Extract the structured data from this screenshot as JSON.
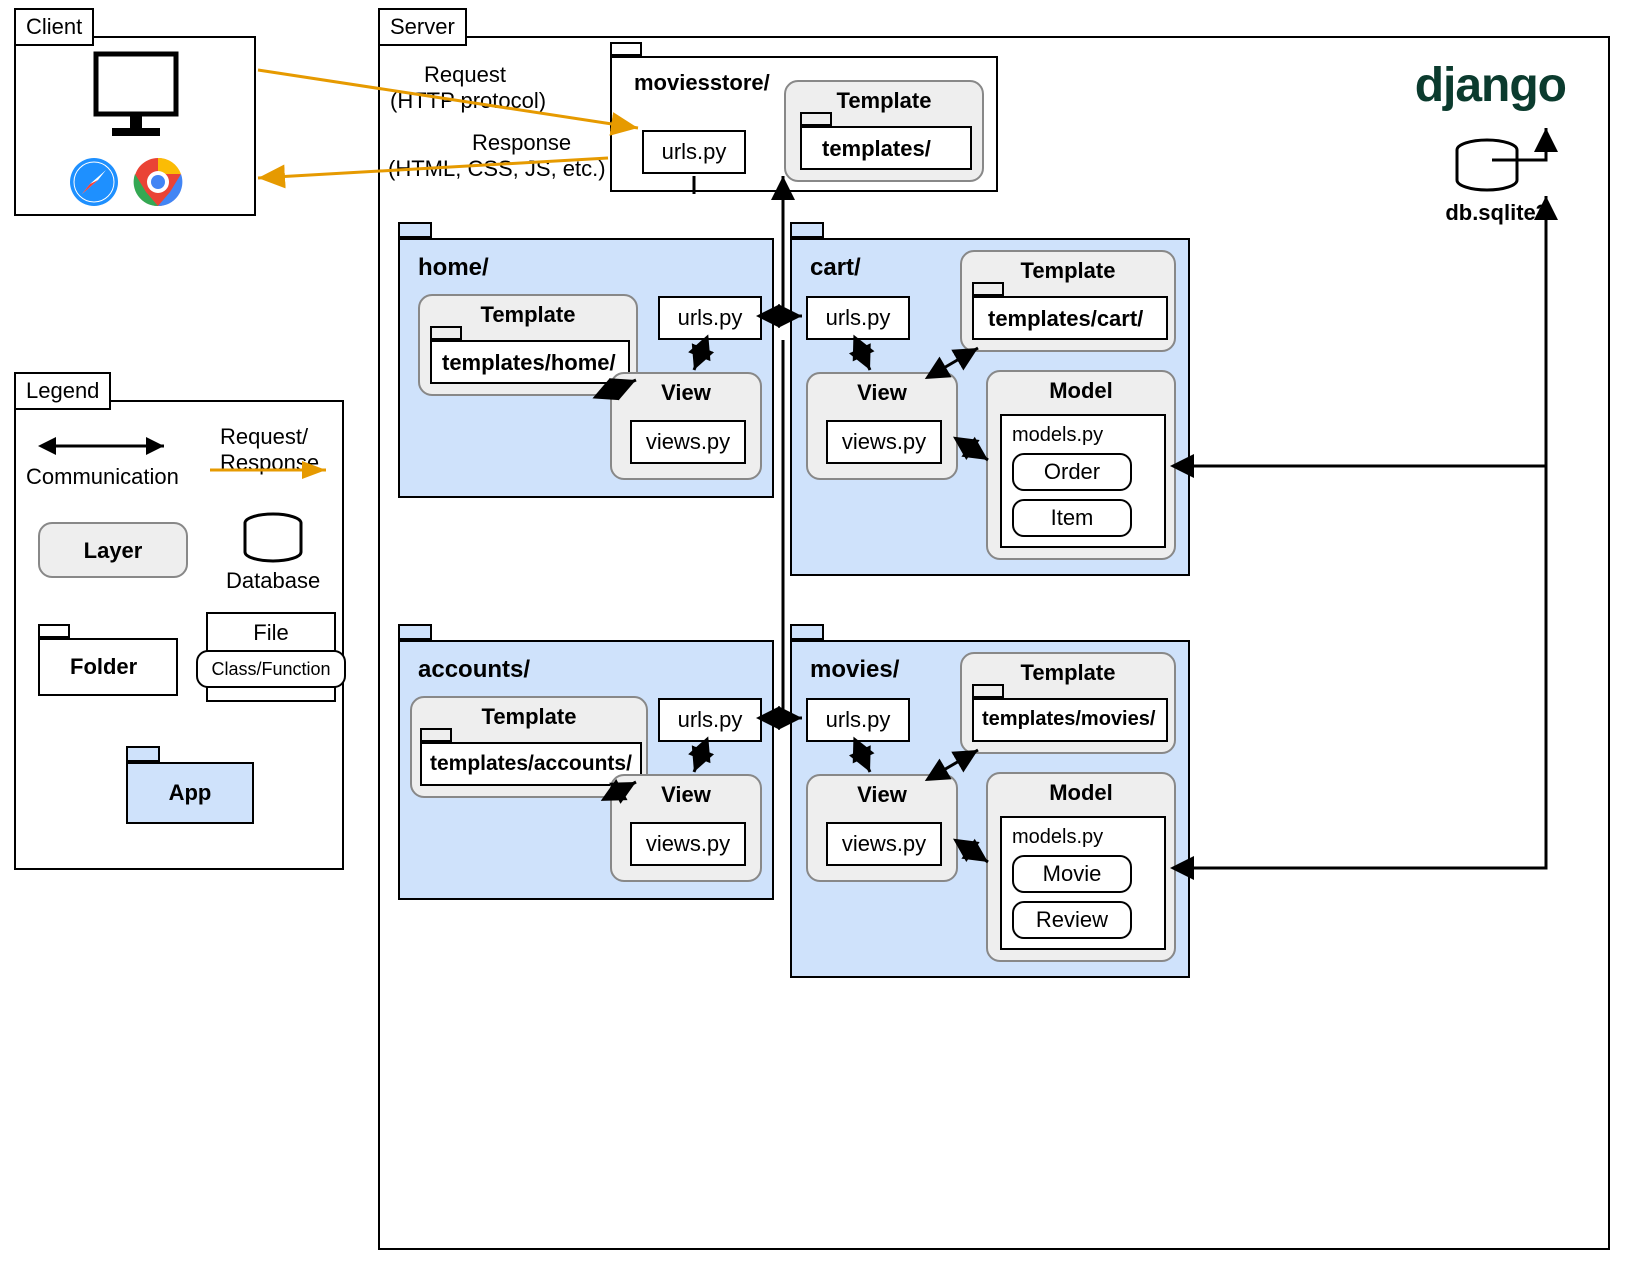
{
  "client": {
    "title": "Client"
  },
  "server": {
    "title": "Server",
    "logo": "django",
    "project": {
      "name": "moviesstore/",
      "urls_file": "urls.py",
      "template": {
        "label": "Template",
        "folder": "templates/"
      }
    },
    "db": {
      "label": "db.sqlite3"
    },
    "apps": {
      "home": {
        "name": "home/",
        "urls": "urls.py",
        "template": {
          "label": "Template",
          "folder": "templates/home/"
        },
        "view": {
          "label": "View",
          "file": "views.py"
        }
      },
      "cart": {
        "name": "cart/",
        "urls": "urls.py",
        "template": {
          "label": "Template",
          "folder": "templates/cart/"
        },
        "view": {
          "label": "View",
          "file": "views.py"
        },
        "model": {
          "label": "Model",
          "file": "models.py",
          "classes": [
            "Order",
            "Item"
          ]
        }
      },
      "accounts": {
        "name": "accounts/",
        "urls": "urls.py",
        "template": {
          "label": "Template",
          "folder": "templates/accounts/"
        },
        "view": {
          "label": "View",
          "file": "views.py"
        }
      },
      "movies": {
        "name": "movies/",
        "urls": "urls.py",
        "template": {
          "label": "Template",
          "folder": "templates/movies/"
        },
        "view": {
          "label": "View",
          "file": "views.py"
        },
        "model": {
          "label": "Model",
          "file": "models.py",
          "classes": [
            "Movie",
            "Review"
          ]
        }
      }
    }
  },
  "arrows": {
    "request_l1": "Request",
    "request_l2": "(HTTP protocol)",
    "response_l1": "Response",
    "response_l2": "(HTML, CSS, JS, etc.)"
  },
  "legend": {
    "title": "Legend",
    "comm": "Communication",
    "rr": "Request/\nResponse",
    "layer": "Layer",
    "database": "Database",
    "folder": "Folder",
    "file": "File",
    "classfn": "Class/Function",
    "app": "App"
  }
}
